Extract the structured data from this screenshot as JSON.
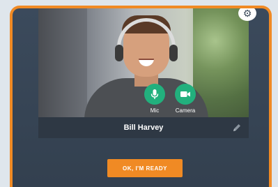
{
  "video": {
    "controls": {
      "mic_label": "Mic",
      "camera_label": "Camera"
    },
    "participant_name": "Bill Harvey"
  },
  "ready_button_label": "OK, I'M READY",
  "colors": {
    "accent": "#f08a24",
    "control_green": "#22b07d",
    "panel_bg": "#3b4a5c",
    "name_bar_bg": "#2e3844"
  },
  "icons": {
    "settings": "gear-icon",
    "mic": "microphone-icon",
    "camera": "video-camera-icon",
    "edit_name": "pencil-icon"
  }
}
